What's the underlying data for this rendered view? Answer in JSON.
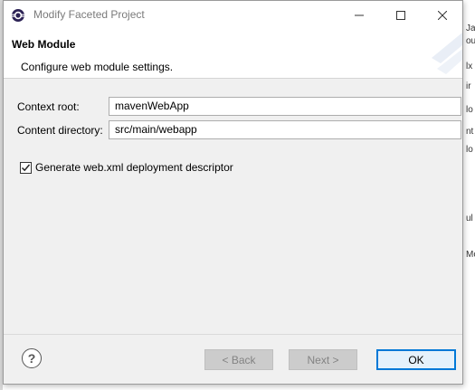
{
  "window": {
    "title": "Modify Faceted Project",
    "minimize_icon": "minimize-icon",
    "maximize_icon": "maximize-icon",
    "close_icon": "close-icon"
  },
  "header": {
    "title": "Web Module",
    "description": "Configure web module settings."
  },
  "form": {
    "context_root": {
      "label": "Context root:",
      "value": "mavenWebApp"
    },
    "content_directory": {
      "label": "Content directory:",
      "value": "src/main/webapp"
    },
    "generate_descriptor": {
      "label": "Generate web.xml deployment descriptor",
      "checked": true
    }
  },
  "footer": {
    "help_label": "?",
    "back_label": "< Back",
    "next_label": "Next >",
    "ok_label": "OK"
  },
  "background": {
    "fragments": [
      "Ja",
      "ou",
      "lx",
      "ir",
      "lo",
      "nt",
      "lo",
      "ul",
      "Mo"
    ]
  },
  "colors": {
    "accent": "#0078d7",
    "dialog_bg": "#f0f0f0",
    "header_bg": "#ffffff"
  }
}
